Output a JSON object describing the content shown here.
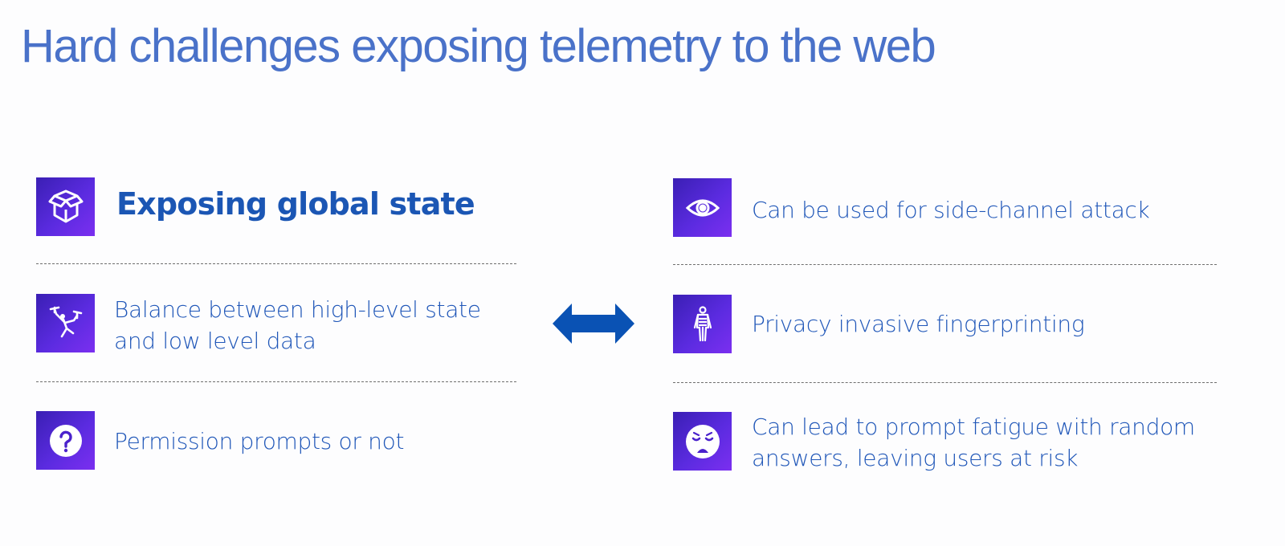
{
  "slide": {
    "title": "Hard challenges exposing telemetry to the web"
  },
  "left": {
    "heading": "Exposing global state",
    "items": [
      {
        "line1": "Balance between high-level state",
        "line2": "and low level data"
      },
      {
        "line1": "Permission prompts or not"
      }
    ]
  },
  "right": {
    "items": [
      {
        "line1": "Can be used for side-channel attack"
      },
      {
        "line1": "Privacy invasive fingerprinting"
      },
      {
        "line1": "Can lead to prompt fatigue with random",
        "line2": "answers, leaving users at risk"
      }
    ]
  },
  "icons": [
    "box-icon",
    "juggler-icon",
    "question-icon",
    "eye-icon",
    "body-scan-icon",
    "sad-face-icon",
    "double-arrow-icon"
  ],
  "colors": {
    "title": "#4a72c9",
    "text": "#1f56b8",
    "tile_start": "#3a1fb4",
    "tile_end": "#7b2ff0",
    "arrow": "#0a52b4"
  }
}
